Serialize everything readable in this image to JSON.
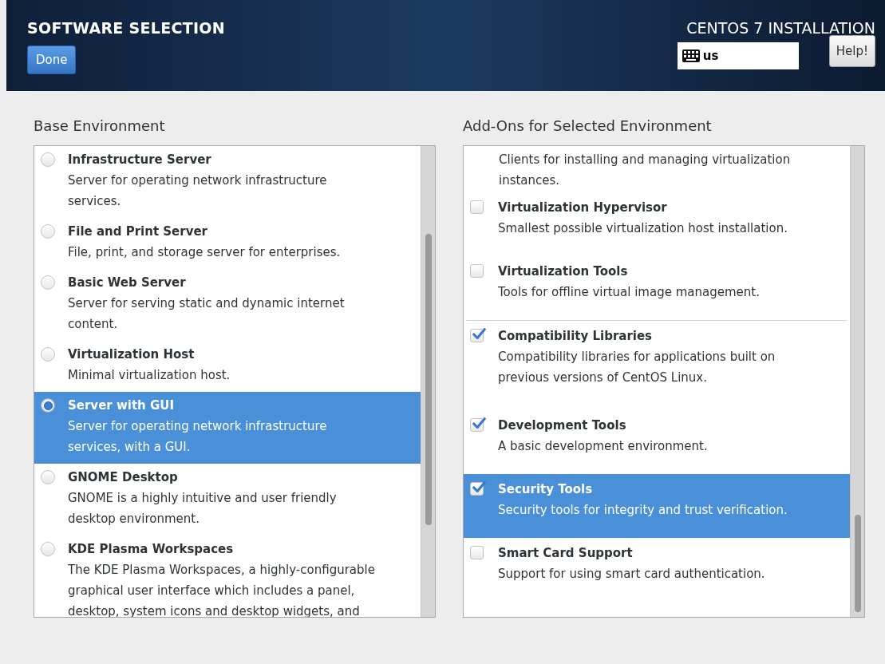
{
  "header": {
    "title": "SOFTWARE SELECTION",
    "done_button": "Done",
    "product": "CENTOS 7 INSTALLATION",
    "keyboard_layout": "us",
    "help_button": "Help!"
  },
  "base_environment": {
    "heading": "Base Environment",
    "items": [
      {
        "name": "Infrastructure Server",
        "description": "Server for operating network infrastructure services.",
        "selected": false
      },
      {
        "name": "File and Print Server",
        "description": "File, print, and storage server for enterprises.",
        "selected": false
      },
      {
        "name": "Basic Web Server",
        "description": "Server for serving static and dynamic internet content.",
        "selected": false
      },
      {
        "name": "Virtualization Host",
        "description": "Minimal virtualization host.",
        "selected": false
      },
      {
        "name": "Server with GUI",
        "description": "Server for operating network infrastructure services, with a GUI.",
        "selected": true
      },
      {
        "name": "GNOME Desktop",
        "description": "GNOME is a highly intuitive and user friendly desktop environment.",
        "selected": false
      },
      {
        "name": "KDE Plasma Workspaces",
        "description": "The KDE Plasma Workspaces, a highly-configurable graphical user interface which includes a panel, desktop, system icons and desktop widgets, and",
        "selected": false
      }
    ]
  },
  "addons": {
    "heading": "Add-Ons for Selected Environment",
    "items": [
      {
        "kind": "continuation",
        "description": "Clients for installing and managing virtualization instances.",
        "selected": false,
        "group_start": false
      },
      {
        "kind": "option",
        "name": "Virtualization Hypervisor",
        "description": "Smallest possible virtualization host installation.",
        "checked": false,
        "selected": false,
        "group_start": false
      },
      {
        "kind": "option",
        "name": "Virtualization Tools",
        "description": "Tools for offline virtual image management.",
        "checked": false,
        "selected": false,
        "group_start": false
      },
      {
        "kind": "option",
        "name": "Compatibility Libraries",
        "description": "Compatibility libraries for applications built on previous versions of CentOS Linux.",
        "checked": true,
        "selected": false,
        "group_start": true
      },
      {
        "kind": "option",
        "name": "Development Tools",
        "description": "A basic development environment.",
        "checked": true,
        "selected": false,
        "group_start": false
      },
      {
        "kind": "option",
        "name": "Security Tools",
        "description": "Security tools for integrity and trust verification.",
        "checked": true,
        "selected": true,
        "group_start": false
      },
      {
        "kind": "option",
        "name": "Smart Card Support",
        "description": "Support for using smart card authentication.",
        "checked": false,
        "selected": false,
        "group_start": false
      }
    ]
  }
}
